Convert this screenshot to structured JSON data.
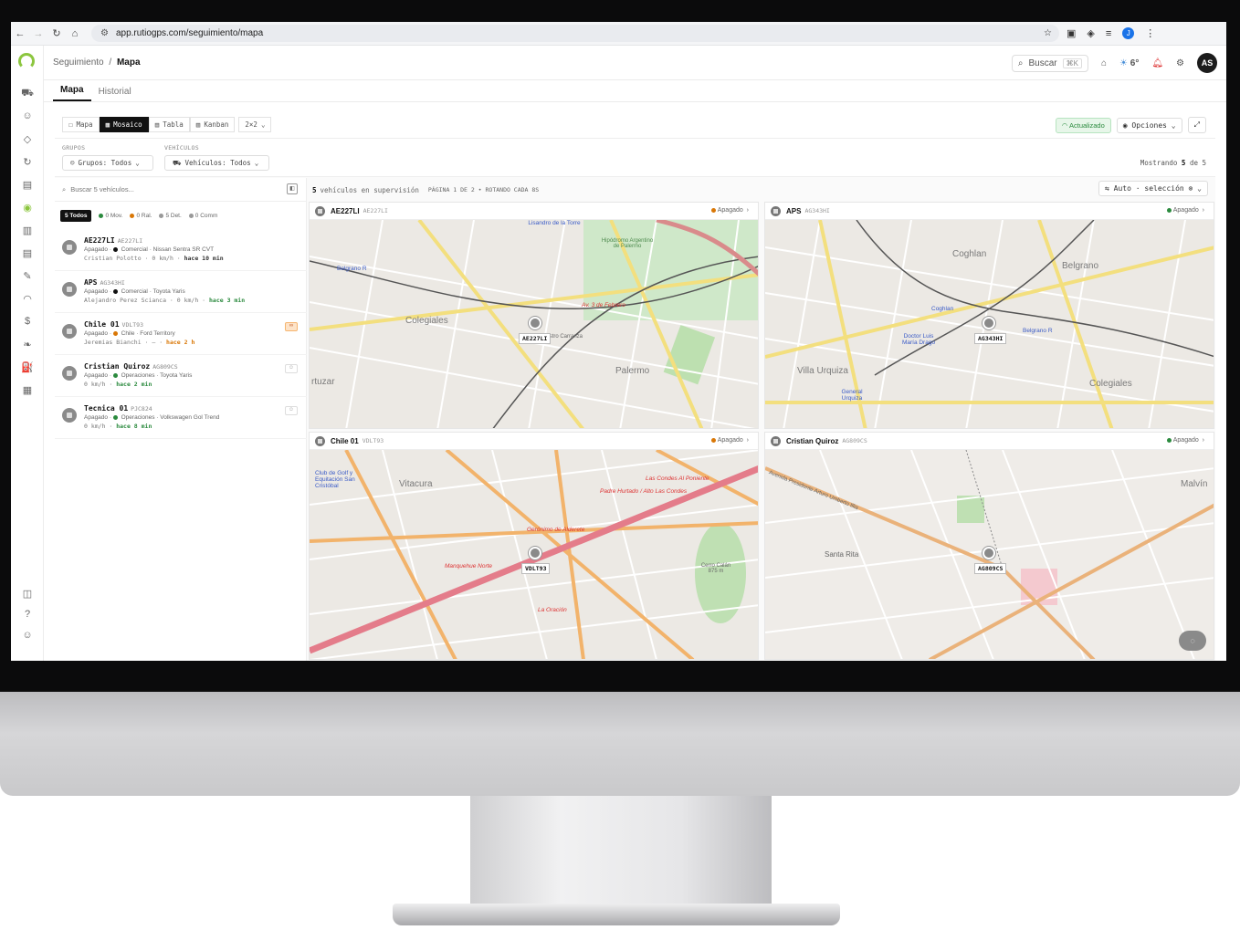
{
  "browser": {
    "url": "app.rutiogps.com/seguimiento/mapa",
    "profile_initial": "J"
  },
  "topbar": {
    "crumb_parent": "Seguimiento",
    "crumb_sep": "/",
    "crumb_current": "Mapa",
    "search_label": "Buscar",
    "search_kbd": "⌘K",
    "weather": "6°",
    "avatar": "AS"
  },
  "tabs": [
    {
      "label": "Mapa"
    },
    {
      "label": "Historial"
    }
  ],
  "toolbar": {
    "views": [
      {
        "label": "Mapa"
      },
      {
        "label": "Mosaico"
      },
      {
        "label": "Tabla"
      },
      {
        "label": "Kanban"
      }
    ],
    "grid": "2×2",
    "status": "Actualizado",
    "options": "Opciones"
  },
  "filters": {
    "groups_label": "GRUPOS",
    "groups_value": "Grupos: Todos",
    "vehicles_label": "VEHÍCULOS",
    "vehicles_value": "Vehículos: Todos",
    "showing_prefix": "Mostrando",
    "showing_count": "5",
    "showing_suffix": "de 5"
  },
  "panel": {
    "search_placeholder": "Buscar 5 vehículos...",
    "status_all": "5 Todos",
    "status_mov": "0 Mov.",
    "status_ral": "0 Ral.",
    "status_det": "5 Det.",
    "status_comm": "0 Comm"
  },
  "vehicles": [
    {
      "name": "AE227LI",
      "plate": "AE227LI",
      "state": "Apagado",
      "group": "Comercial",
      "model": "Nissan Sentra SR CVT",
      "driver": "Cristian Polotto",
      "speed": "0 km/h",
      "time": "hace 10 min"
    },
    {
      "name": "APS",
      "plate": "AG343HI",
      "state": "Apagado",
      "group": "Comercial",
      "model": "Toyota Yaris",
      "driver": "Alejandro Perez Scianca",
      "speed": "0 km/h",
      "time": "hace 3 min"
    },
    {
      "name": "Chile 01",
      "plate": "VDLT93",
      "state": "Apagado",
      "group": "Chile",
      "model": "Ford Territory",
      "driver": "Jeremias Bianchi",
      "speed": "—",
      "time": "hace 2 h"
    },
    {
      "name": "Cristian Quiroz",
      "plate": "AG809CS",
      "state": "Apagado",
      "group": "Operaciones",
      "model": "Toyota Yaris",
      "driver": "",
      "speed": "0 km/h",
      "time": "hace 2 min"
    },
    {
      "name": "Tecnica 01",
      "plate": "PJC824",
      "state": "Apagado",
      "group": "Operaciones",
      "model": "Volkswagen Gol Trend",
      "driver": "",
      "speed": "0 km/h",
      "time": "hace 8 min"
    }
  ],
  "mosaic": {
    "count": "5",
    "label": "vehículos en supervisión",
    "page": "PÁGINA 1 DE 2 • ROTANDO CADA 8S",
    "auto_select": "⇆ Auto · selección"
  },
  "tiles": [
    {
      "name": "AE227LI",
      "plate": "AE227LI",
      "status": "Apagado",
      "marker_label": "AE227LI",
      "places": [
        "Colegiales",
        "Palermo",
        "Belgrano R",
        "Lisandro de la Torre",
        "Hipódromo Argentino de Palermo",
        "Av. 3 de Febrero",
        "nistro Carranza",
        "rtuzar"
      ]
    },
    {
      "name": "APS",
      "plate": "AG343HI",
      "status": "Apagado",
      "marker_label": "AG343HI",
      "places": [
        "Coghlan",
        "Belgrano",
        "Villa Urquiza",
        "Colegiales",
        "Doctor Luis María Drago",
        "General Urquiza",
        "Belgrano R",
        "Coghlan"
      ]
    },
    {
      "name": "Chile 01",
      "plate": "VDLT93",
      "status": "Apagado",
      "marker_label": "VDLT93",
      "places": [
        "Vitacura",
        "Las Condes Al Poniente",
        "Padre Hurtado / Alto Las Condes",
        "Gerónimo de Alderete",
        "Manquehue Norte",
        "Cerro Calán 875 m",
        "Club de Golf y Equitación San Cristóbal",
        "La Oración"
      ]
    },
    {
      "name": "Cristian Quiroz",
      "plate": "AG809CS",
      "status": "Apagado",
      "marker_label": "AG809CS",
      "places": [
        "Santa Rita",
        "Malvín",
        "Avenida Presidente Arturo Umberto Illia"
      ]
    }
  ],
  "colors": {
    "green": "#2b8a3e",
    "orange": "#d97706",
    "dark": "#111111",
    "map_bg": "#ece9e4"
  }
}
